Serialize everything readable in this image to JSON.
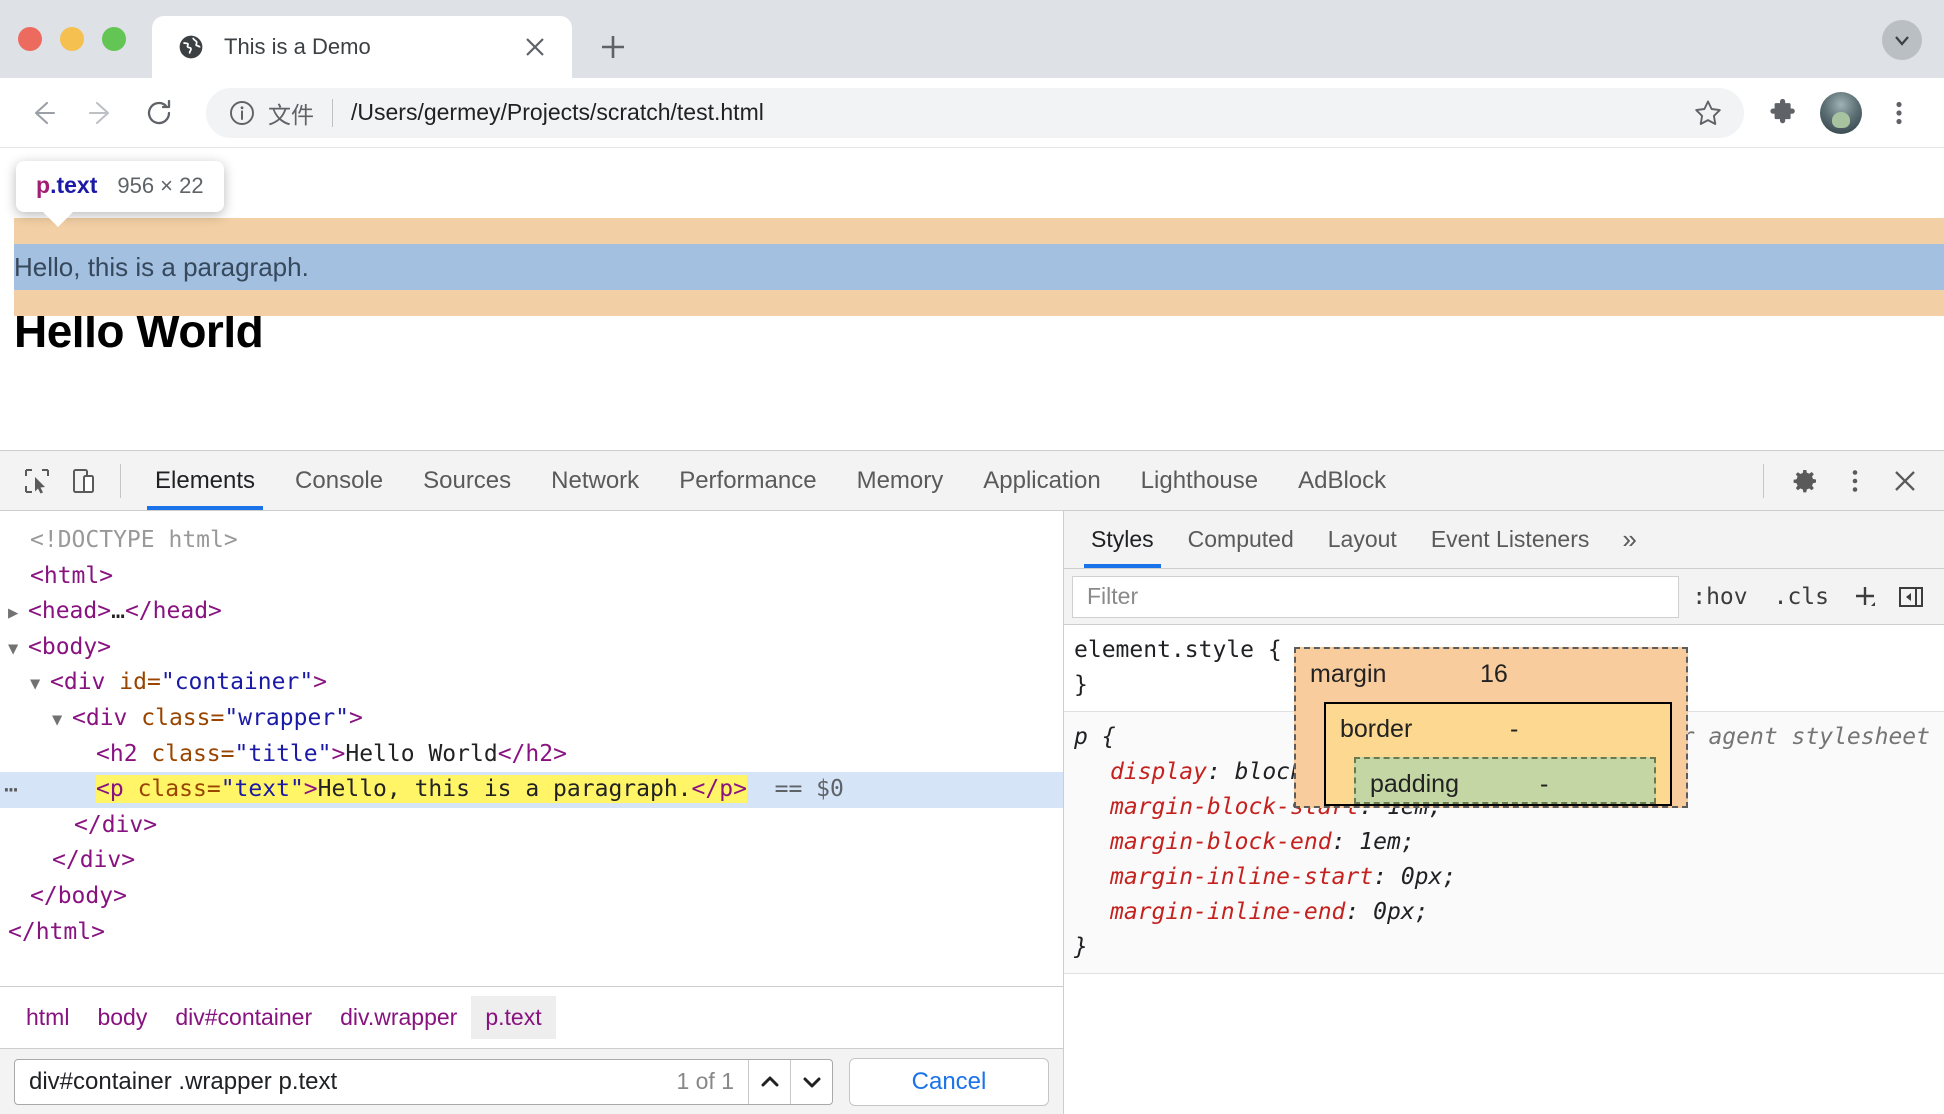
{
  "browser": {
    "tab": {
      "title": "This is a Demo",
      "favicon": "globe-icon",
      "close": "×"
    },
    "new_tab_label": "+",
    "omnibox": {
      "scheme_label": "文件",
      "url": "/Users/germey/Projects/scratch/test.html"
    },
    "controls": {
      "back": "←",
      "forward": "→",
      "reload": "⟳",
      "bookmark": "star-icon",
      "extensions": "puzzle-icon",
      "profile": "avatar",
      "menu": "three-dot-icon",
      "tabstrip_menu": "chevron-down-icon"
    }
  },
  "page": {
    "heading": "Hello World",
    "paragraph": "Hello, this is a paragraph.",
    "tooltip": {
      "tag": "p",
      "class": ".text",
      "size": "956 × 22"
    },
    "highlight_colors": {
      "margin": "#f2cfa4",
      "content": "#a3c0e0"
    }
  },
  "devtools": {
    "tabs": [
      {
        "label": "Elements",
        "active": true
      },
      {
        "label": "Console",
        "active": false
      },
      {
        "label": "Sources",
        "active": false
      },
      {
        "label": "Network",
        "active": false
      },
      {
        "label": "Performance",
        "active": false
      },
      {
        "label": "Memory",
        "active": false
      },
      {
        "label": "Application",
        "active": false
      },
      {
        "label": "Lighthouse",
        "active": false
      },
      {
        "label": "AdBlock",
        "active": false
      }
    ],
    "toolbar_icons": {
      "inspect": "inspect-cursor-icon",
      "device": "device-toolbar-icon",
      "settings": "gear-icon",
      "more": "three-dot-icon",
      "close": "close-icon"
    },
    "dom": {
      "lines": [
        {
          "indent": 0,
          "doctype": "<!DOCTYPE html>"
        },
        {
          "indent": 0,
          "tag_open": "<html>"
        },
        {
          "indent": 0,
          "twisty": "collapsed",
          "tag_open": "<head>",
          "ellipsis": "…",
          "tag_close": "</head>"
        },
        {
          "indent": 0,
          "twisty": "expanded",
          "tag_open": "<body>"
        },
        {
          "indent": 1,
          "twisty": "expanded",
          "tag": "div",
          "attr": "id",
          "value": "container"
        },
        {
          "indent": 2,
          "twisty": "expanded",
          "tag": "div",
          "attr": "class",
          "value": "wrapper"
        },
        {
          "indent": 3,
          "tag": "h2",
          "attr": "class",
          "value": "title",
          "text": "Hello World",
          "closing": "</h2>"
        },
        {
          "indent": 3,
          "selected": true,
          "tag": "p",
          "attr": "class",
          "value": "text",
          "text": "Hello, this is a paragraph.",
          "closing": "</p>",
          "suffix": "== $0",
          "dots": "⋯"
        },
        {
          "indent": 2,
          "tag_close": "</div>"
        },
        {
          "indent": 1,
          "tag_close": "</div>"
        },
        {
          "indent": 0,
          "tag_close": "</body>"
        },
        {
          "indent": 0,
          "tag_close": "</html>"
        }
      ]
    },
    "breadcrumb": [
      {
        "label": "html",
        "active": false
      },
      {
        "label": "body",
        "active": false
      },
      {
        "label": "div#container",
        "active": false
      },
      {
        "label": "div.wrapper",
        "active": false
      },
      {
        "label": "p.text",
        "active": true
      }
    ],
    "search": {
      "value": "div#container .wrapper p.text",
      "count": "1 of 1",
      "prev_icon": "chevron-up-icon",
      "next_icon": "chevron-down-icon",
      "cancel_label": "Cancel"
    },
    "styles": {
      "tabs": [
        {
          "label": "Styles",
          "active": true
        },
        {
          "label": "Computed",
          "active": false
        },
        {
          "label": "Layout",
          "active": false
        },
        {
          "label": "Event Listeners",
          "active": false
        }
      ],
      "more_tabs": "»",
      "filter": {
        "placeholder": "Filter"
      },
      "filter_buttons": [
        ":hov",
        ".cls"
      ],
      "add_rule_icon": "plus-icon",
      "toggle_sidebar_icon": "panel-toggle-icon",
      "rules": [
        {
          "selector": "element.style",
          "open_brace": "{",
          "close_brace": "}",
          "origin": "",
          "declarations": []
        },
        {
          "selector": "p",
          "open_brace": "{",
          "close_brace": "}",
          "origin": "user agent stylesheet",
          "declarations": [
            {
              "property": "display",
              "value": "block"
            },
            {
              "property": "margin-block-start",
              "value": "1em"
            },
            {
              "property": "margin-block-end",
              "value": "1em"
            },
            {
              "property": "margin-inline-start",
              "value": "0px"
            },
            {
              "property": "margin-inline-end",
              "value": "0px"
            }
          ]
        }
      ],
      "box_model": {
        "margin": {
          "label": "margin",
          "value": "16",
          "color": "#f9cc9d"
        },
        "border": {
          "label": "border",
          "value": "-",
          "color": "#fdd891"
        },
        "padding": {
          "label": "padding",
          "value": "-",
          "color": "#c4d6a4"
        }
      }
    }
  }
}
